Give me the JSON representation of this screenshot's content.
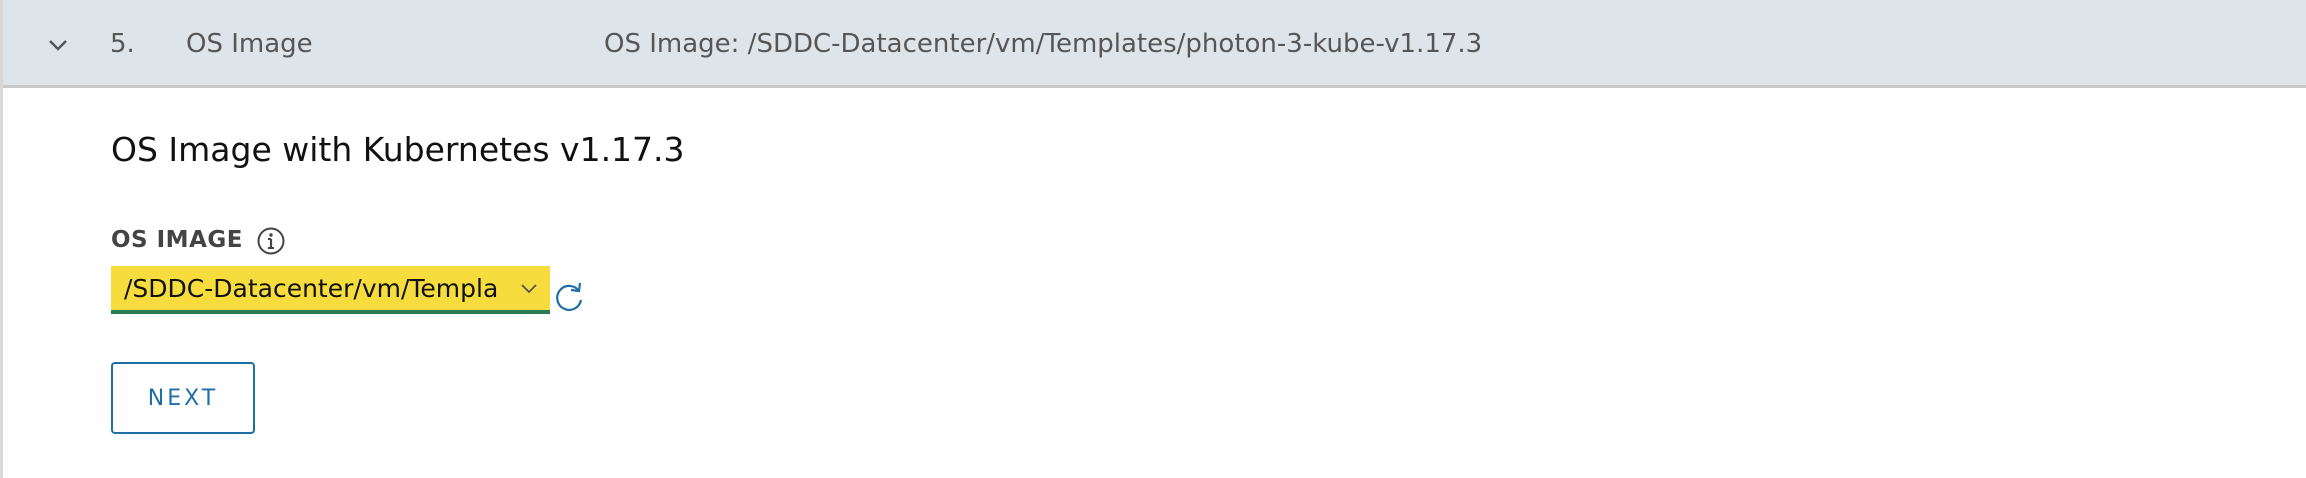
{
  "header": {
    "step_number": "5.",
    "step_title": "OS Image",
    "step_summary": "OS Image: /SDDC-Datacenter/vm/Templates/photon-3-kube-v1.17.3",
    "expand_icon": "chevron-down-icon"
  },
  "content": {
    "title": "OS Image with Kubernetes v1.17.3",
    "os_image_field": {
      "label": "OS IMAGE",
      "info_icon": "info-icon",
      "selected_value": "/SDDC-Datacenter/vm/Templa",
      "refresh_icon": "refresh-icon"
    },
    "next_button_label": "NEXT"
  },
  "colors": {
    "header_bg": "#dde5ea",
    "select_highlight": "#f6dd3d",
    "select_underline": "#2a7c57",
    "primary": "#1f6fa7"
  }
}
